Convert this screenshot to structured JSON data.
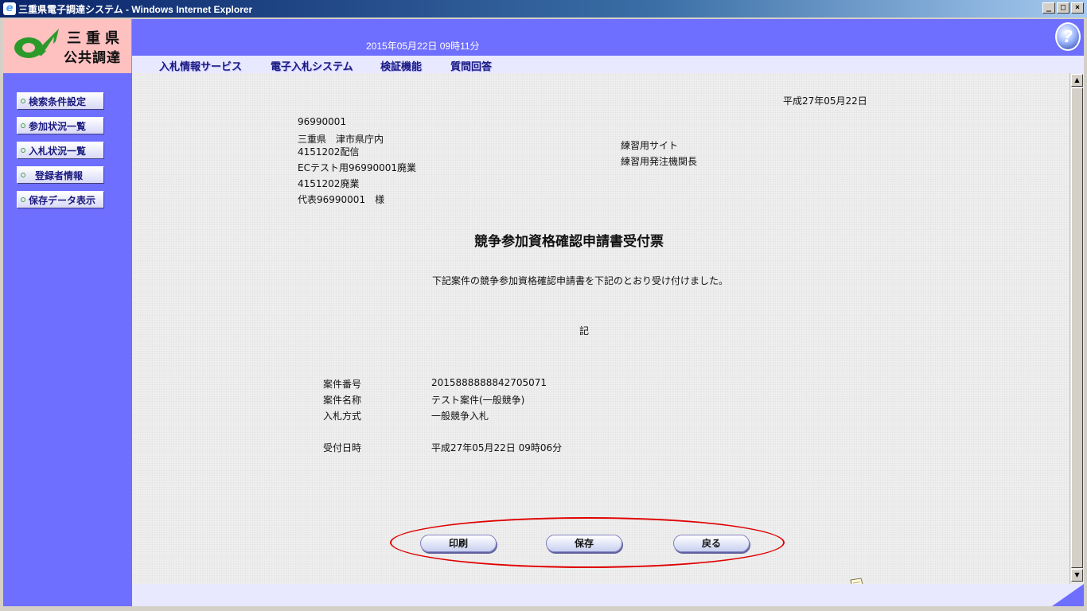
{
  "window": {
    "title": "三重県電子調達システム - Windows Internet Explorer",
    "minimize": "_",
    "maximize": "□",
    "close": "×"
  },
  "header": {
    "logo_line1": "三重県",
    "logo_line2": "公共調達",
    "datetime": "2015年05月22日 09時11分",
    "help_glyph": "?"
  },
  "menu": {
    "items": [
      "入札情報サービス",
      "電子入札システム",
      "検証機能",
      "質問回答"
    ]
  },
  "sidebar": {
    "items": [
      "検索条件設定",
      "参加状況一覧",
      "入札状況一覧",
      "登録者情報",
      "保存データ表示"
    ]
  },
  "document": {
    "date": "平成27年05月22日",
    "recipient": {
      "line1": "96990001",
      "line2": "三重県　津市県庁内",
      "line3": "4151202配信",
      "line4": "ECテスト用96990001廃業",
      "line5": "4151202廃業",
      "line6": "代表96990001　様"
    },
    "sender": {
      "line1": "練習用サイト",
      "line2": "練習用発注機関長"
    },
    "title": "競争参加資格確認申請書受付票",
    "body": "下記案件の競争参加資格確認申請書を下記のとおり受け付けました。",
    "ki": "記",
    "fields": [
      {
        "label": "案件番号",
        "value": "2015888888842705071"
      },
      {
        "label": "案件名称",
        "value": "テスト案件(一般競争)"
      },
      {
        "label": "入札方式",
        "value": "一般競争入札"
      },
      {
        "label": "受付日時",
        "value": "平成27年05月22日 09時06分"
      }
    ]
  },
  "buttons": {
    "print": "印刷",
    "save": "保存",
    "back": "戻る"
  },
  "colors": {
    "frame": "#6e6eff",
    "logo_bg": "#ffc0c0",
    "menu_bg": "#e8e8ff",
    "highlight": "#e00000"
  }
}
